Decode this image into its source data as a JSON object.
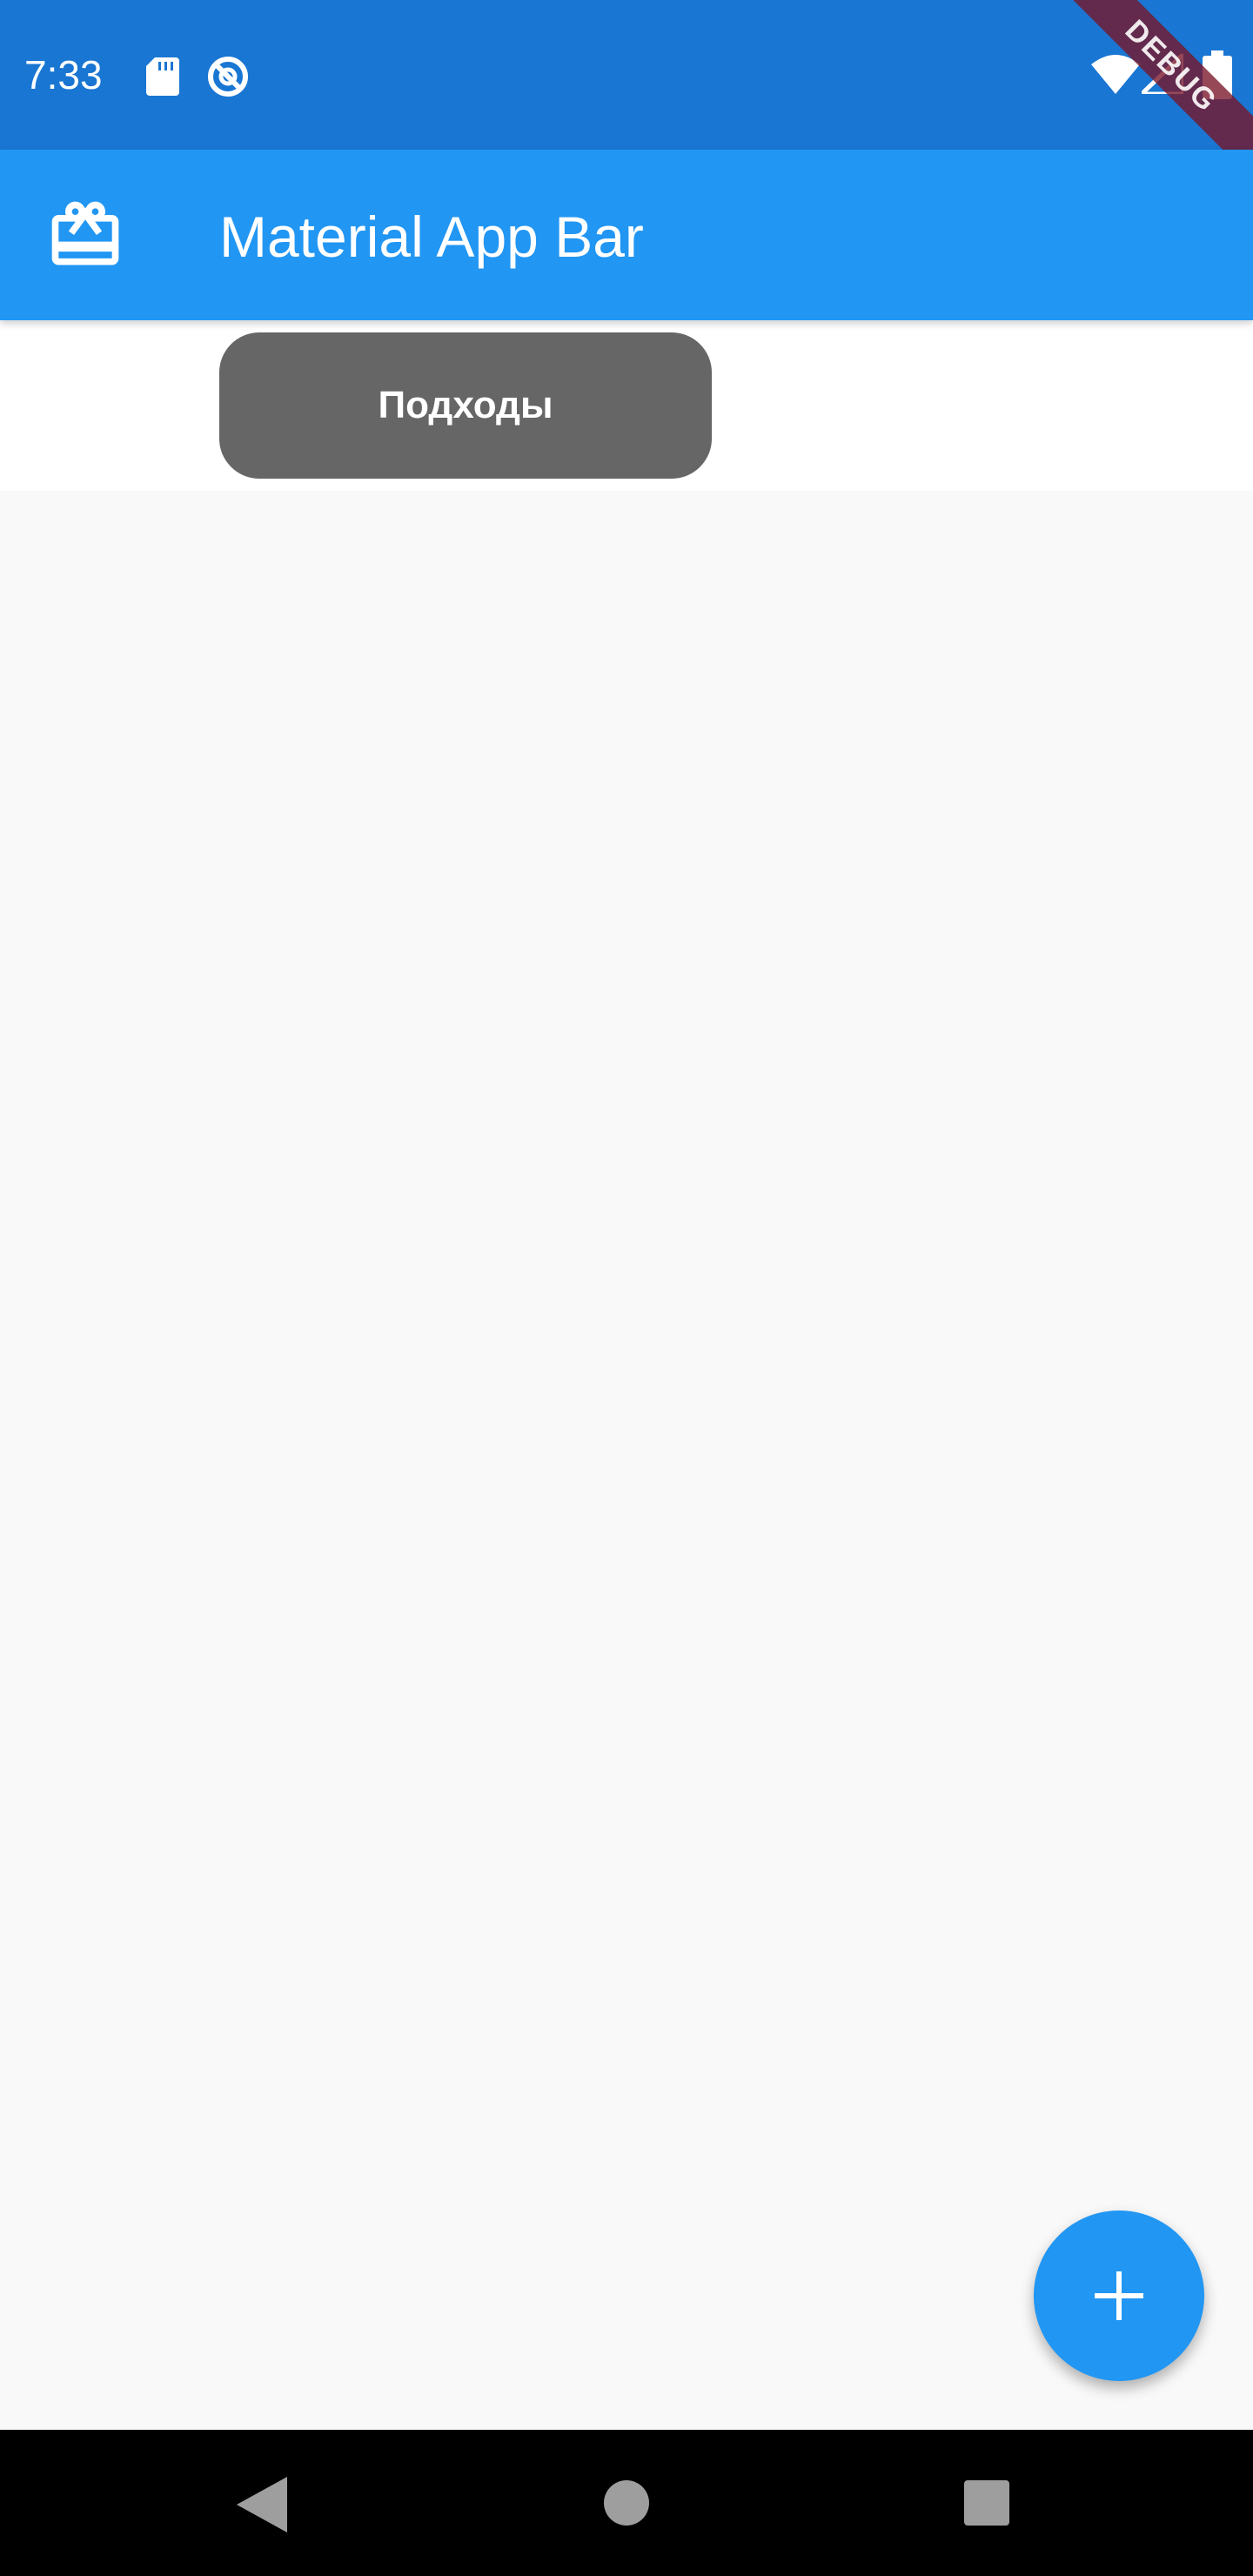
{
  "status_bar": {
    "time": "7:33",
    "icons": [
      "sd-card-icon",
      "no-sync-icon",
      "wifi-icon",
      "signal-icon",
      "battery-icon"
    ]
  },
  "debug_banner": {
    "label": "DEBUG"
  },
  "app_bar": {
    "title": "Material App Bar",
    "leading_icon": "card-giftcard-icon",
    "color": "#2196f3"
  },
  "chip_area": {
    "chip_label": "Подходы",
    "chip_color": "#666666"
  },
  "fab": {
    "icon": "plus-icon",
    "color": "#2196f3"
  },
  "nav_bar": {
    "buttons": [
      "back-icon",
      "home-icon",
      "recents-icon"
    ]
  },
  "colors": {
    "status_bar": "#1976d2",
    "background": "#f9f9f9"
  }
}
